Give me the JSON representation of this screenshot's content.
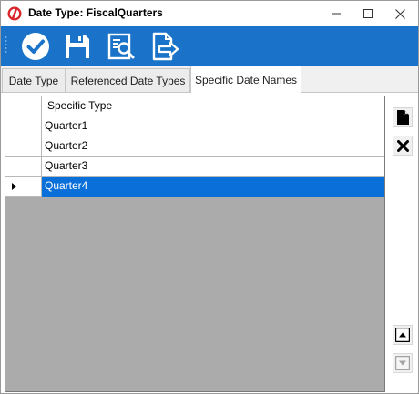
{
  "window": {
    "title": "Date Type: FiscalQuarters",
    "app_icon": "app-logo-icon",
    "controls": [
      "minimize-icon",
      "maximize-icon",
      "close-icon"
    ]
  },
  "toolbar": {
    "accent_color": "#1a73c9",
    "buttons": [
      "check-icon",
      "save-icon",
      "preview-icon",
      "export-icon"
    ]
  },
  "tabs": [
    {
      "label": "Date Type",
      "active": false
    },
    {
      "label": "Referenced Date Types",
      "active": false
    },
    {
      "label": "Specific Date Names",
      "active": true
    }
  ],
  "grid": {
    "columns": [
      "Specific Type"
    ],
    "rows": [
      {
        "value": "Quarter1",
        "selected": false
      },
      {
        "value": "Quarter2",
        "selected": false
      },
      {
        "value": "Quarter3",
        "selected": false
      },
      {
        "value": "Quarter4",
        "selected": true
      }
    ],
    "selection_color": "#0a6fd8"
  },
  "side_buttons": {
    "new": "new-document-icon",
    "delete": "delete-x-icon",
    "move_up": "move-up-icon",
    "move_down": "move-down-icon"
  }
}
